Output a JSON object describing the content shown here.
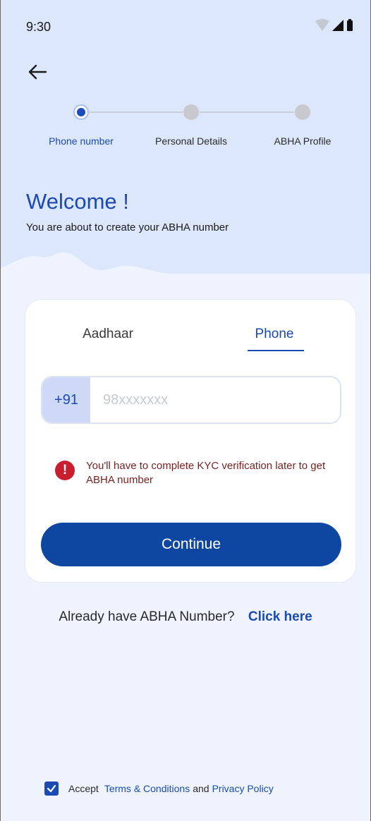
{
  "status_bar": {
    "time": "9:30"
  },
  "stepper": {
    "steps": [
      {
        "label": "Phone number",
        "active": true
      },
      {
        "label": "Personal Details",
        "active": false
      },
      {
        "label": "ABHA Profile",
        "active": false
      }
    ]
  },
  "welcome": {
    "title": "Welcome !",
    "subtitle": "You are about to create your ABHA number"
  },
  "card": {
    "tabs": [
      {
        "label": "Aadhaar",
        "selected": false
      },
      {
        "label": "Phone",
        "selected": true
      }
    ],
    "country_code": "+91",
    "phone_value": "",
    "phone_placeholder": "98xxxxxxx",
    "warning": "You'll have to complete KYC verification later to get ABHA number",
    "continue_label": "Continue"
  },
  "already": {
    "question": "Already have ABHA Number?",
    "link": "Click here"
  },
  "terms": {
    "checked": true,
    "accept": "Accept",
    "terms_link": "Terms & Conditions",
    "and": "and",
    "privacy_link": "Privacy Policy"
  },
  "colors": {
    "primary": "#0d47a1",
    "accent": "#1b4ab3",
    "warning": "#c81e2e",
    "header_bg": "#dde7fb",
    "page_bg": "#eef3fd"
  }
}
